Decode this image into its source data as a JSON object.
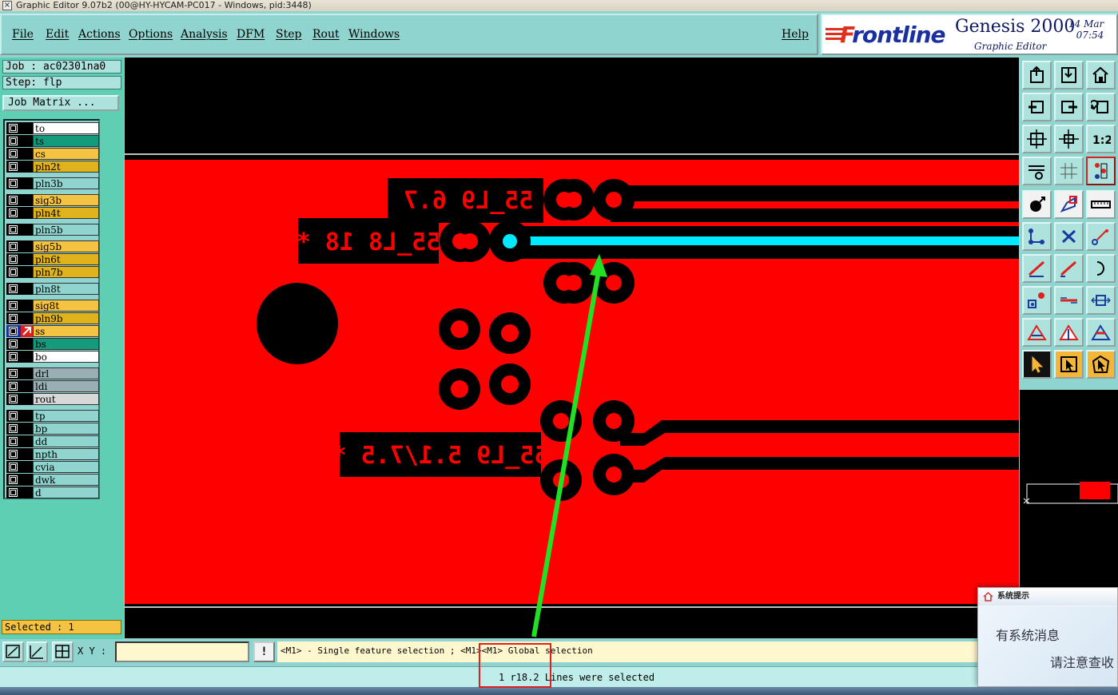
{
  "window": {
    "title": "Graphic Editor 9.07b2 (00@HY-HYCAM-PC017 - Windows, pid:3448)"
  },
  "menu": {
    "items": [
      "File",
      "Edit",
      "Actions",
      "Options",
      "Analysis",
      "DFM",
      "Step",
      "Rout",
      "Windows"
    ],
    "help": "Help"
  },
  "brand": {
    "logo_prefix": "F",
    "logo_rest": "rontline",
    "product": "Genesis 2000",
    "subtitle": "Graphic Editor",
    "date": "14 Mar",
    "time": "07:54"
  },
  "job": {
    "job_line": "Job : ac02301na0",
    "step_line": "Step: flp",
    "job_matrix_button": "Job Matrix ..."
  },
  "layers": [
    {
      "name": "to",
      "color": "#ffffff"
    },
    {
      "name": "ts",
      "color": "#139b7c"
    },
    {
      "name": "cs",
      "color": "#f5c342"
    },
    {
      "name": "pln2t",
      "color": "#e0b21c"
    },
    {
      "name": "pln3b",
      "color": "#8fd4cf"
    },
    {
      "name": "sig3b",
      "color": "#f5c342"
    },
    {
      "name": "pln4t",
      "color": "#e0b21c"
    },
    {
      "name": "pln5b",
      "color": "#8fd4cf"
    },
    {
      "name": "sig5b",
      "color": "#f5c342"
    },
    {
      "name": "pln6t",
      "color": "#e0b21c"
    },
    {
      "name": "pln7b",
      "color": "#e0b21c"
    },
    {
      "name": "pln8t",
      "color": "#8fd4cf"
    },
    {
      "name": "sig8t",
      "color": "#f5c342"
    },
    {
      "name": "pln9b",
      "color": "#e0b21c"
    },
    {
      "name": "ss",
      "color": "#f5c342",
      "active": true
    },
    {
      "name": "bs",
      "color": "#139b7c"
    },
    {
      "name": "bo",
      "color": "#ffffff"
    },
    {
      "name": "drl",
      "color": "#9aafb4"
    },
    {
      "name": "ldi",
      "color": "#9aafb4"
    },
    {
      "name": "rout",
      "color": "#d8d8d8"
    },
    {
      "name": "tp",
      "color": "#8fd4cf"
    },
    {
      "name": "bp",
      "color": "#8fd4cf"
    },
    {
      "name": "dd",
      "color": "#8fd4cf"
    },
    {
      "name": "npth",
      "color": "#8fd4cf"
    },
    {
      "name": "cvia",
      "color": "#8fd4cf"
    },
    {
      "name": "dwk",
      "color": "#8fd4cf"
    },
    {
      "name": "d",
      "color": "#8fd4cf"
    }
  ],
  "selection": {
    "label": "Selected : 1"
  },
  "canvas": {
    "texts": [
      "55_L9 6.7 *",
      "55_L8 18 *",
      "55_L9 5.1/7.5 *"
    ],
    "board_color": "#ff0000",
    "highlight_color": "#00eaff",
    "arrow_color": "#22e022"
  },
  "command": {
    "xy_label": "X Y :",
    "xy_value": "",
    "bang": "!",
    "prompt": "<M1> - Single feature selection ; <M1><M1> Global selection"
  },
  "status": {
    "text": "1 r18.2 Lines were selected"
  },
  "popup": {
    "title": "系统提示",
    "line1": "有系统消息",
    "line2": "请注意查收"
  }
}
